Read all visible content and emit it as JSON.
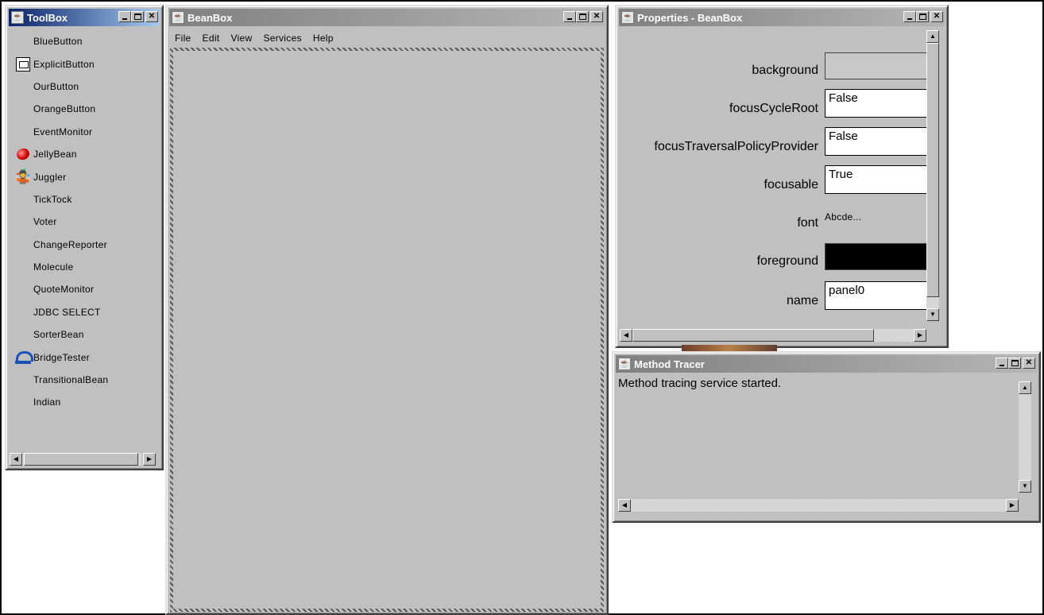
{
  "toolbox": {
    "title": "ToolBox",
    "items": [
      {
        "label": "BlueButton",
        "icon": ""
      },
      {
        "label": "ExplicitButton",
        "icon": "button-icon"
      },
      {
        "label": "OurButton",
        "icon": ""
      },
      {
        "label": "OrangeButton",
        "icon": ""
      },
      {
        "label": "EventMonitor",
        "icon": ""
      },
      {
        "label": "JellyBean",
        "icon": "jellybean-icon"
      },
      {
        "label": "Juggler",
        "icon": "juggler-icon"
      },
      {
        "label": "TickTock",
        "icon": ""
      },
      {
        "label": "Voter",
        "icon": ""
      },
      {
        "label": "ChangeReporter",
        "icon": ""
      },
      {
        "label": "Molecule",
        "icon": ""
      },
      {
        "label": "QuoteMonitor",
        "icon": ""
      },
      {
        "label": "JDBC SELECT",
        "icon": ""
      },
      {
        "label": "SorterBean",
        "icon": ""
      },
      {
        "label": "BridgeTester",
        "icon": "bridge-icon"
      },
      {
        "label": "TransitionalBean",
        "icon": ""
      },
      {
        "label": "Indian",
        "icon": ""
      }
    ]
  },
  "beanbox": {
    "title": "BeanBox",
    "menu": [
      "File",
      "Edit",
      "View",
      "Services",
      "Help"
    ]
  },
  "properties": {
    "title": "Properties - BeanBox",
    "rows": [
      {
        "label": "background",
        "kind": "color",
        "value": "",
        "color": "#c8c8c8"
      },
      {
        "label": "focusCycleRoot",
        "kind": "text",
        "value": "False"
      },
      {
        "label": "focusTraversalPolicyProvider",
        "kind": "text",
        "value": "False"
      },
      {
        "label": "focusable",
        "kind": "text",
        "value": "True"
      },
      {
        "label": "font",
        "kind": "font",
        "value": "Abcde..."
      },
      {
        "label": "foreground",
        "kind": "color",
        "value": "",
        "color": "#000000"
      },
      {
        "label": "name",
        "kind": "text",
        "value": "panel0"
      }
    ]
  },
  "tracer": {
    "title": "Method Tracer",
    "text": "Method tracing service started."
  },
  "colors": {
    "window_bg": "#c0c0c0",
    "active_title": "#0a246a",
    "inactive_title": "#808080"
  }
}
